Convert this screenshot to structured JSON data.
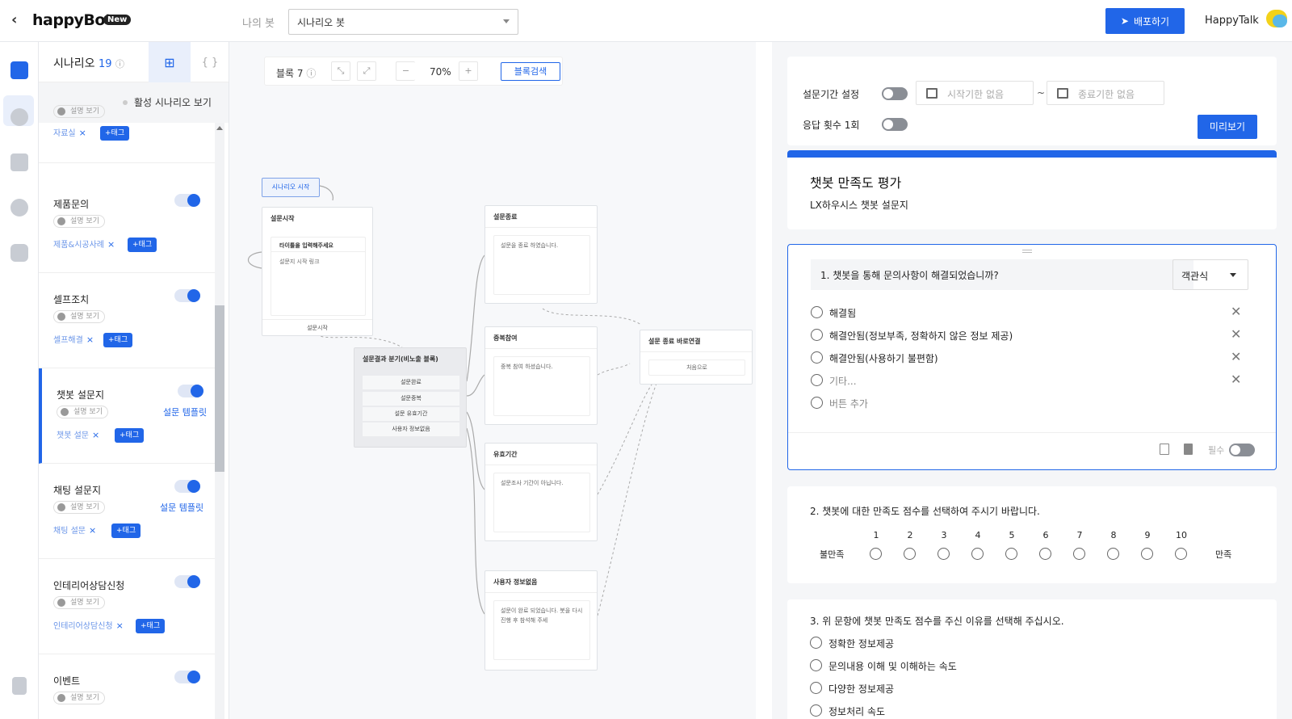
{
  "header": {
    "logo": "happyBot",
    "logo_badge": "New",
    "bot_label": "나의 봇",
    "bot_select": "시나리오 봇",
    "deploy_label": "배포하기",
    "user_name": "HappyTalk"
  },
  "sidebar": {
    "title": "시나리오",
    "count": "19",
    "active_filter_label": "활성 시나리오 보기",
    "desc_label": "설명 보기",
    "top_partial": {
      "desc": "설명 보기",
      "tag": "자료실",
      "add_tag": "+태그"
    },
    "items": [
      {
        "name": "제품문의",
        "desc": "설명 보기",
        "tag": "제품&시공사례",
        "add_tag": "+태그",
        "template": ""
      },
      {
        "name": "셀프조치",
        "desc": "설명 보기",
        "tag": "셀프해결",
        "add_tag": "+태그",
        "template": ""
      },
      {
        "name": "챗봇 설문지",
        "desc": "설명 보기",
        "tag": "챗봇 설문",
        "add_tag": "+태그",
        "template": "설문 템플릿"
      },
      {
        "name": "채팅 설문지",
        "desc": "설명 보기",
        "tag": "채팅 설문",
        "add_tag": "+태그",
        "template": "설문 템플릿"
      },
      {
        "name": "인테리어상담신청",
        "desc": "설명 보기",
        "tag": "인테리어상담신청",
        "add_tag": "+태그",
        "template": ""
      },
      {
        "name": "이벤트",
        "desc": "설명 보기",
        "tag": "",
        "add_tag": "",
        "template": ""
      }
    ]
  },
  "canvas": {
    "block_label": "블록",
    "block_count": "7",
    "zoom": "70%",
    "search_label": "블록검색",
    "start_node": "시나리오 시작",
    "nodes": {
      "survey_start": {
        "title": "설문시작",
        "box_title": "타이틀을 입력해주세요",
        "box_text": "설문지 시작 링크",
        "foot": "설문시작"
      },
      "branch": {
        "title": "설문결과 분기(비노출 블록)",
        "rows": [
          "설문완료",
          "설문중복",
          "설문 유효기간",
          "사용자 정보없음"
        ]
      },
      "survey_end": {
        "title": "설문종료",
        "text": "설문을 종료 하였습니다."
      },
      "duplicate": {
        "title": "중복참여",
        "text": "중복 참여 하셨습니다."
      },
      "expiry": {
        "title": "유효기간",
        "text": "설문조사 기간이 아닙니다."
      },
      "no_user": {
        "title": "사용자 정보없음",
        "text": "설문이 완료 되었습니다. 봇을 다시 진행 후 참석해 주세"
      },
      "end_link": {
        "title": "설문 종료 바로연결",
        "button": "처음으로"
      }
    }
  },
  "survey": {
    "period_label": "설문기간 설정",
    "start_placeholder": "시작기한 없음",
    "range_sep": "~",
    "end_placeholder": "종료기한 없음",
    "response_label": "응답 횟수 1회",
    "preview_label": "미리보기",
    "title": "챗봇 만족도 평가",
    "subtitle": "LX하우시스 챗봇 설문지",
    "accent": "#2166e8",
    "q1": {
      "text": "1. 챗봇을 통해 문의사항이 해결되었습니까?",
      "type": "객관식",
      "options": [
        "해결됨",
        "해결안됨(정보부족, 정확하지 않은 정보 제공)",
        "해결안됨(사용하기 불편함)",
        "기타..."
      ],
      "add_option": "버튼 추가",
      "required_label": "필수"
    },
    "q2": {
      "text": "2. 챗봇에 대한 만족도 점수를 선택하여 주시기 바랍니다.",
      "scale": [
        "1",
        "2",
        "3",
        "4",
        "5",
        "6",
        "7",
        "8",
        "9",
        "10"
      ],
      "min_label": "불만족",
      "max_label": "만족"
    },
    "q3": {
      "text": "3. 위 문항에 챗봇 만족도 점수를 주신 이유를 선택해 주십시오.",
      "options": [
        "정확한 정보제공",
        "문의내용 이해 및 이해하는 속도",
        "다양한 정보제공",
        "정보처리 속도"
      ]
    }
  }
}
